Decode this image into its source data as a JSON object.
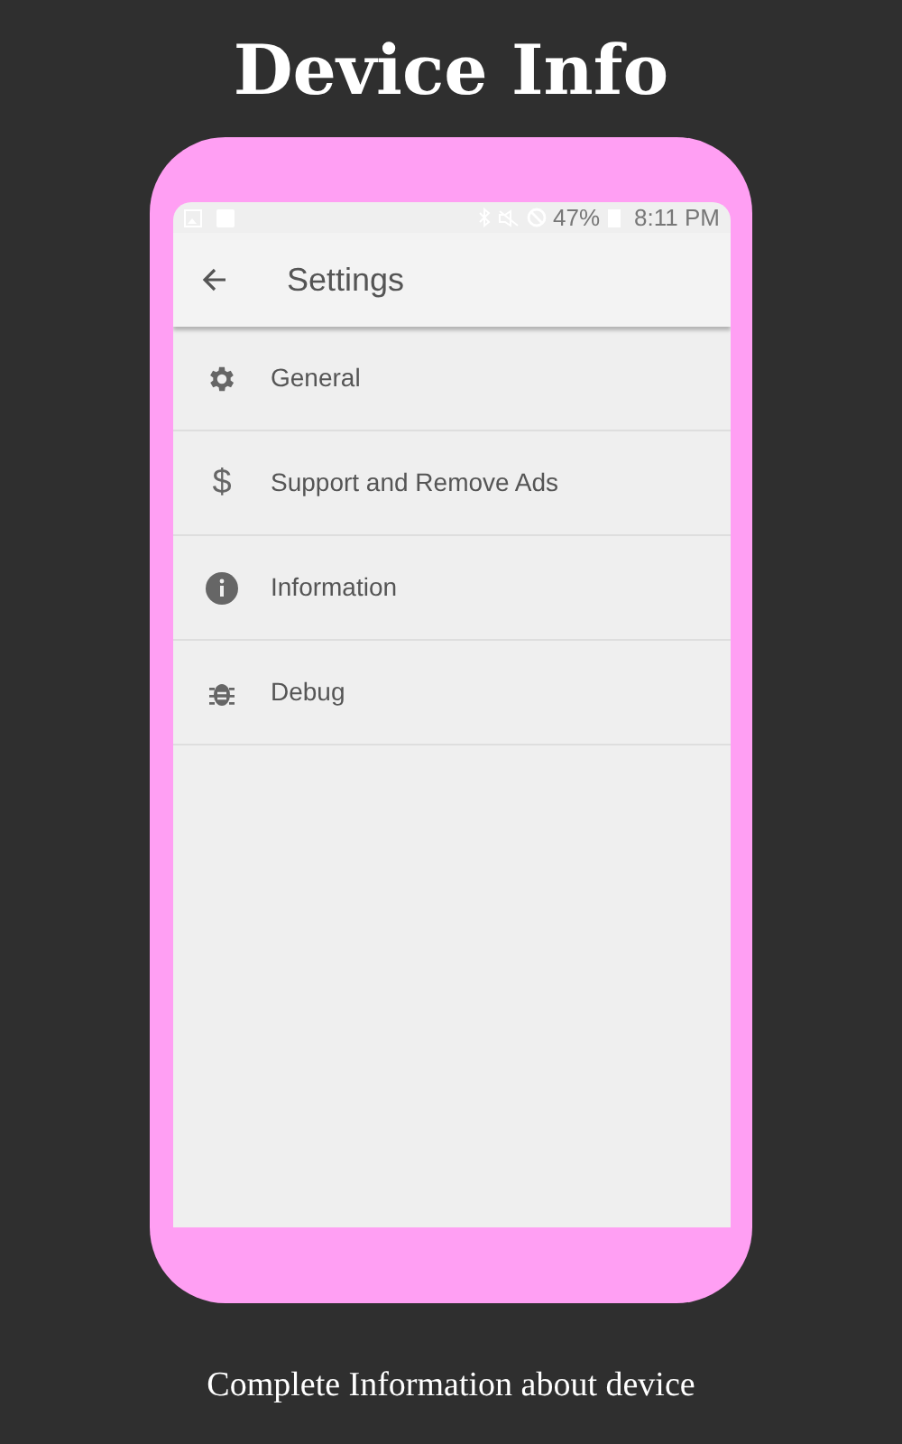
{
  "title": "Device Info",
  "phone": {
    "status_bar": {
      "battery": "47%",
      "time": "8:11 PM"
    },
    "toolbar": {
      "title": "Settings"
    },
    "items": [
      {
        "kind": "gear",
        "label": "General"
      },
      {
        "kind": "glyph",
        "glyph": "$",
        "label": "Support and Remove Ads"
      },
      {
        "kind": "info",
        "label": "Information"
      },
      {
        "kind": "bug",
        "label": "Debug"
      }
    ]
  },
  "caption": "Complete Information about device"
}
